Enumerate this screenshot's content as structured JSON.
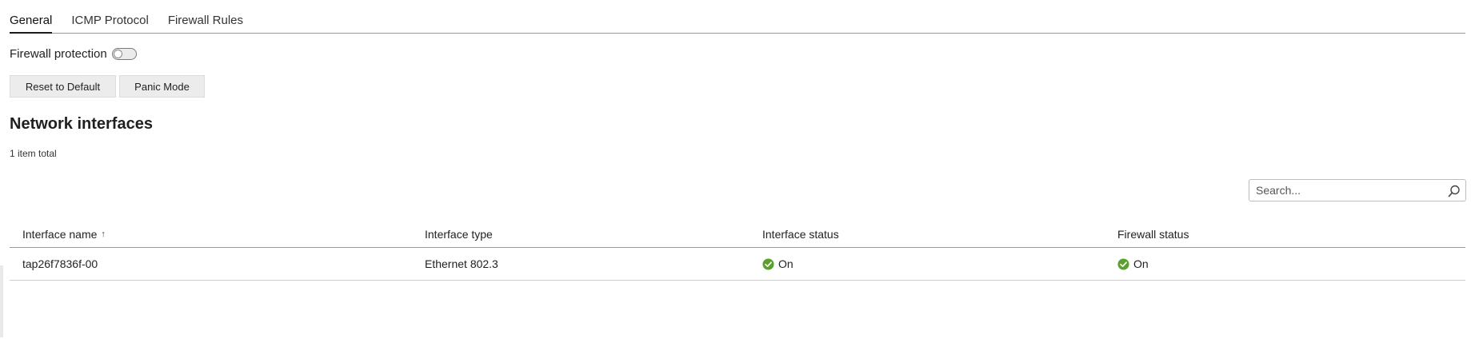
{
  "tabs": [
    {
      "label": "General",
      "active": true
    },
    {
      "label": "ICMP Protocol",
      "active": false
    },
    {
      "label": "Firewall Rules",
      "active": false
    }
  ],
  "firewall_protection": {
    "label": "Firewall protection",
    "enabled": false
  },
  "buttons": {
    "reset": "Reset to Default",
    "panic": "Panic Mode"
  },
  "section": {
    "title": "Network interfaces",
    "item_total": "1 item total"
  },
  "search": {
    "placeholder": "Search..."
  },
  "table": {
    "columns": [
      "Interface name",
      "Interface type",
      "Interface status",
      "Firewall status"
    ],
    "sort_indicator": "↑",
    "rows": [
      {
        "name": "tap26f7836f-00",
        "type": "Ethernet 802.3",
        "interface_status": "On",
        "firewall_status": "On"
      }
    ]
  },
  "colors": {
    "status_on": "#5aa02c",
    "accent": "#1a1a1a"
  },
  "icons": {
    "search": "search-icon",
    "status": "check-circle-icon"
  }
}
